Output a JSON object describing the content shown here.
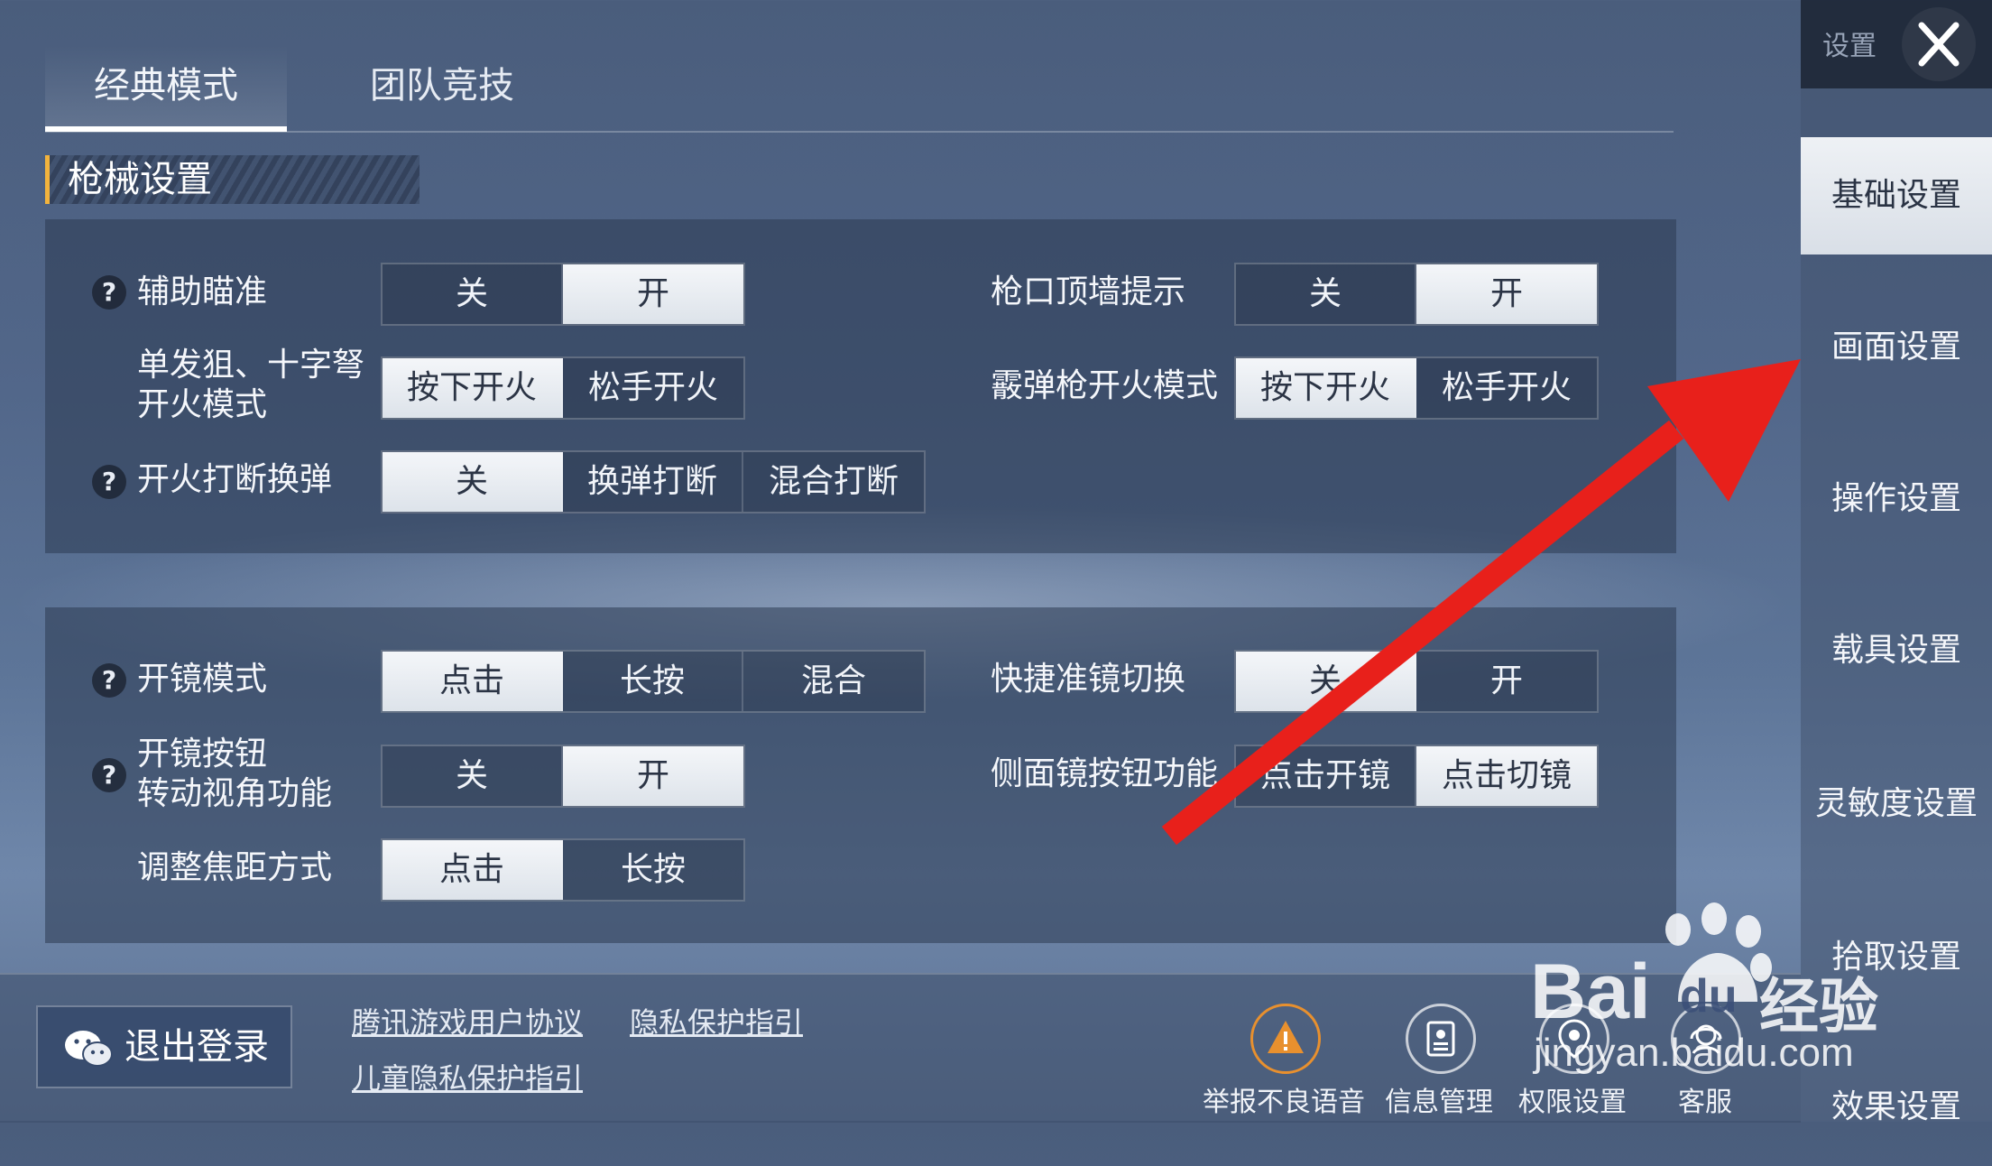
{
  "tabs": {
    "classic": "经典模式",
    "team": "团队竞技"
  },
  "section": {
    "title": "枪械设置"
  },
  "weapon": {
    "aim_assist": {
      "label": "辅助瞄准",
      "options": [
        "关",
        "开"
      ]
    },
    "muzzle_hint": {
      "label": "枪口顶墙提示",
      "options": [
        "关",
        "开"
      ]
    },
    "sniper_fire": {
      "label_line1": "单发狙、十字弩",
      "label_line2": "开火模式",
      "options": [
        "按下开火",
        "松手开火"
      ]
    },
    "shotgun_fire": {
      "label": "霰弹枪开火模式",
      "options": [
        "按下开火",
        "松手开火"
      ]
    },
    "fire_interrupt": {
      "label": "开火打断换弹",
      "options": [
        "关",
        "换弹打断",
        "混合打断"
      ]
    }
  },
  "scope": {
    "scope_mode": {
      "label": "开镜模式",
      "options": [
        "点击",
        "长按",
        "混合"
      ]
    },
    "quick_switch": {
      "label": "快捷准镜切换",
      "options": [
        "关",
        "开"
      ]
    },
    "scope_rotate": {
      "label_line1": "开镜按钮",
      "label_line2": "转动视角功能",
      "options": [
        "关",
        "开"
      ]
    },
    "side_scope": {
      "label": "侧面镜按钮功能",
      "options": [
        "点击开镜",
        "点击切镜"
      ]
    },
    "zoom_mode": {
      "label": "调整焦距方式",
      "options": [
        "点击",
        "长按"
      ]
    }
  },
  "help_mark": "?",
  "sidebar": {
    "title": "设置",
    "items": [
      "基础设置",
      "画面设置",
      "操作设置",
      "载具设置",
      "灵敏度设置",
      "拾取设置",
      "效果设置"
    ]
  },
  "footer": {
    "logout": "退出登录",
    "links": {
      "user_agreement": "腾讯游戏用户协议",
      "privacy": "隐私保护指引",
      "child_privacy": "儿童隐私保护指引"
    },
    "actions": [
      "举报不良语音",
      "信息管理",
      "权限设置",
      "客服"
    ]
  },
  "watermark": {
    "brand": "Bai",
    "brand_du": "du",
    "jingyan": "经验",
    "url": "jingyan.baidu.com"
  },
  "colors": {
    "accent": "#f2b33d",
    "arrow": "#e8201b",
    "report_icon": "#e8902e"
  }
}
